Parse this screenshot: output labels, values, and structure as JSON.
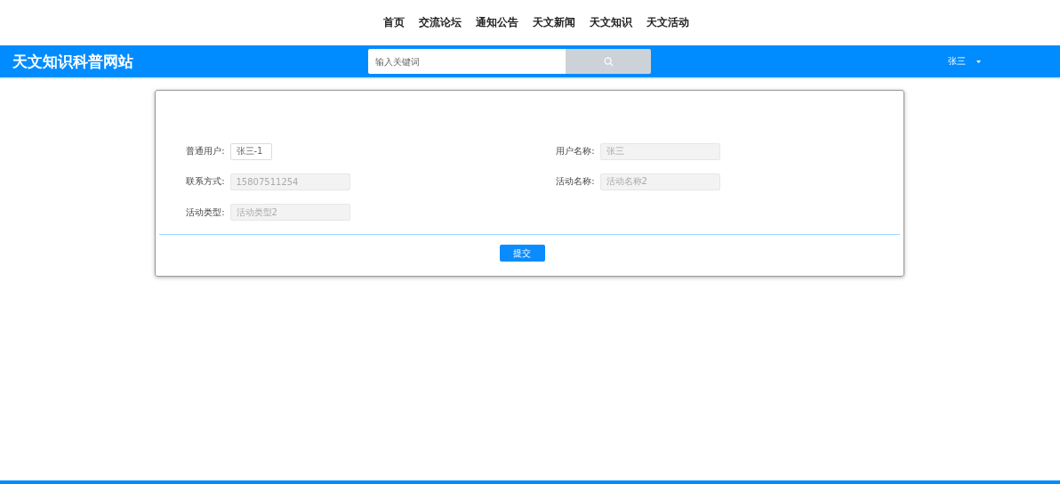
{
  "nav": [
    "首页",
    "交流论坛",
    "通知公告",
    "天文新闻",
    "天文知识",
    "天文活动"
  ],
  "header": {
    "site_title": "天文知识科普网站",
    "search": {
      "placeholder": "输入关键词"
    },
    "user": "张三"
  },
  "form": {
    "fields": [
      {
        "label": "普通用户:",
        "value": "张三-1",
        "disabled": false,
        "kind": "compact"
      },
      {
        "label": "用户名称:",
        "value": "张三",
        "disabled": true,
        "kind": "wide"
      },
      {
        "label": "联系方式:",
        "value": "15807511254",
        "disabled": true,
        "kind": "wide"
      },
      {
        "label": "活动名称:",
        "value": "活动名称2",
        "disabled": true,
        "kind": "wide"
      },
      {
        "label": "活动类型:",
        "value": "活动类型2",
        "disabled": true,
        "kind": "wide"
      }
    ],
    "submit": "提交"
  }
}
